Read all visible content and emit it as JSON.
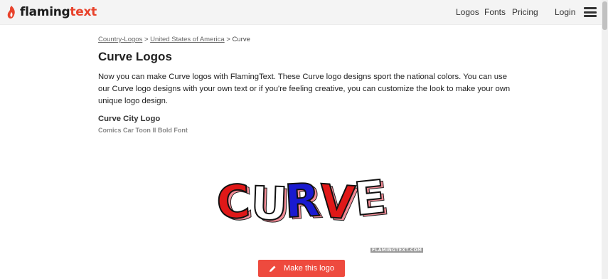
{
  "header": {
    "brand_prefix": "flaming",
    "brand_suffix": "text",
    "nav": {
      "logos": "Logos",
      "fonts": "Fonts",
      "pricing": "Pricing",
      "login": "Login"
    },
    "menu_icon": "hamburger-menu-icon"
  },
  "breadcrumb": {
    "item1": "Country-Logos",
    "sep1": " > ",
    "item2": "United States of America",
    "sep2": " > ",
    "current": "Curve"
  },
  "page": {
    "title": "Curve Logos",
    "description": "Now you can make Curve logos with FlamingText. These Curve logo designs sport the national colors. You can use our Curve logo designs with your own text or if you're feeling creative, you can customize the look to make your own unique logo design."
  },
  "logo_item": {
    "title": "Curve City Logo",
    "font": "Comics Car Toon II Bold Font",
    "preview_letters": [
      "C",
      "U",
      "R",
      "V",
      "E"
    ],
    "preview_colors": [
      "#e01818",
      "#ffffff",
      "#1a1ad0",
      "#e01818",
      "#ffffff"
    ],
    "watermark": "FLAMINGTEXT.COM",
    "button_label": "Make this logo"
  },
  "colors": {
    "accent": "#ee4a3e",
    "header_bg": "#f4f4f4"
  }
}
